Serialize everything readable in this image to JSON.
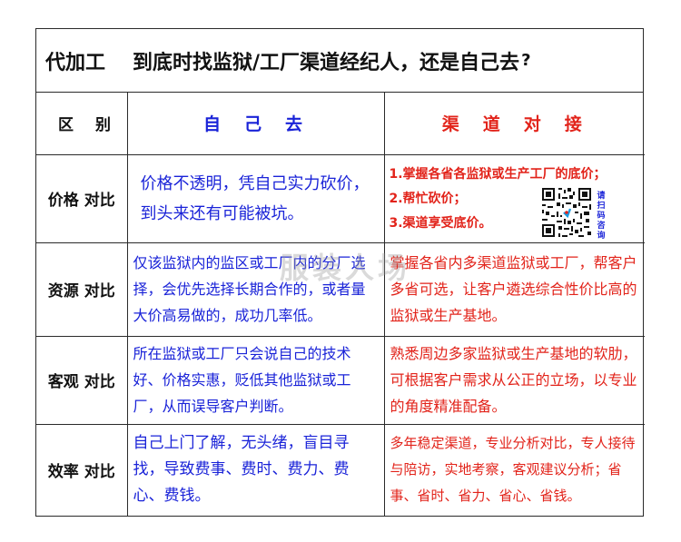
{
  "title": {
    "part1": "代加工",
    "part2": "到底时找监狱/工厂渠道经纪人，还是自己去",
    "question_mark": "?"
  },
  "header": {
    "col1": "区别",
    "col2": "自己去",
    "col3": "渠道对接"
  },
  "rows": [
    {
      "label": "价格 对比",
      "self": "价格不透明，凭自己实力砍价，到头来还有可能被坑。",
      "channel_lines": [
        "1.掌握各省各监狱或生产工厂的底价；",
        "2.帮忙砍价；",
        "3.渠道享受底价。"
      ],
      "qr_text": "请扫码咨询"
    },
    {
      "label": "资源 对比",
      "self": "仅该监狱内的监区或工厂内的分厂选择，会优先选择长期合作的，或者量大价高易做的，成功几率低。",
      "channel": "掌握各省内多渠道监狱或工厂，帮客户多省可选，让客户遴选综合性价比高的监狱或生产基地。"
    },
    {
      "label": "客观 对比",
      "self": "所在监狱或工厂只会说自己的技术好、价格实惠，贬低其他监狱或工厂，从而误导客户判断。",
      "channel": "熟悉周边多家监狱或生产基地的软肋，可根据客户需求从公正的立场，以专业的角度精准配备。"
    },
    {
      "label": "效率 对比",
      "self": "自己上门了解，无头绪，盲目寻找，导致费事、费时、费力、费心、费钱。",
      "channel": "多年稳定渠道，专业分析对比，专人接待与陪访，实地考察，客观建议分析；省事、省时、省力、省心、省钱。"
    }
  ],
  "watermark": "服装人场",
  "colors": {
    "blue": "#1a23d8",
    "red": "#e2231a",
    "border": "#2a2a2a"
  }
}
